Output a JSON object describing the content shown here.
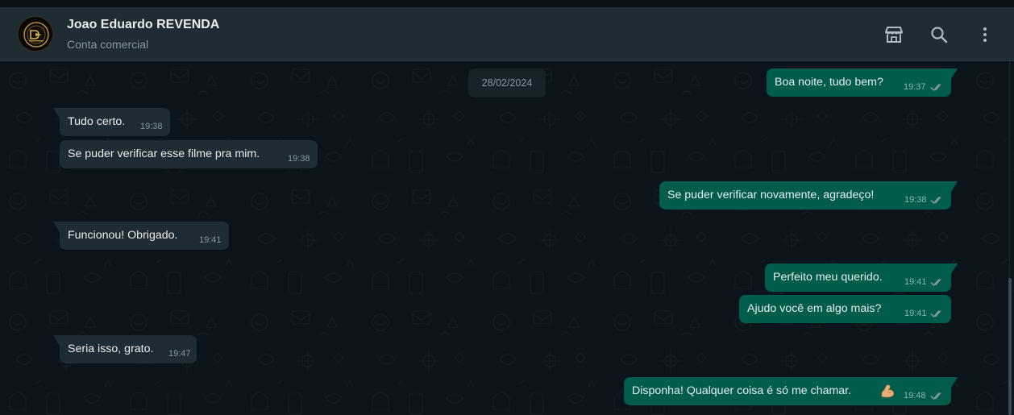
{
  "contact": {
    "name": "Joao Eduardo REVENDA",
    "subtitle": "Conta comercial"
  },
  "header_icons": [
    "shop-icon",
    "search-icon",
    "menu-icon"
  ],
  "date_label": "28/02/2024",
  "messages": [
    {
      "direction": "out",
      "text": "Boa noite, tudo bem?",
      "time": "19:37",
      "status": "read"
    },
    {
      "direction": "in",
      "text": "Tudo certo.",
      "time": "19:38"
    },
    {
      "direction": "in",
      "text": "Se puder verificar esse filme pra mim.",
      "time": "19:38"
    },
    {
      "direction": "out",
      "text": "Se puder verificar novamente, agradeço!",
      "time": "19:38",
      "status": "read"
    },
    {
      "direction": "in",
      "text": "Funcionou! Obrigado.",
      "time": "19:41"
    },
    {
      "direction": "out",
      "text": "Perfeito meu querido.",
      "time": "19:41",
      "status": "read"
    },
    {
      "direction": "out",
      "text": "Ajudo você em algo mais?",
      "time": "19:41",
      "status": "read"
    },
    {
      "direction": "in",
      "text": "Seria isso, grato.",
      "time": "19:47"
    },
    {
      "direction": "out",
      "text": "Disponha! Qualquer coisa é só me chamar.",
      "emoji": "flexed-biceps",
      "time": "19:48",
      "status": "read"
    }
  ],
  "colors": {
    "header_bg": "#202c33",
    "chat_bg": "#0b141a",
    "incoming_bubble": "#202c33",
    "outgoing_bubble": "#005c4b",
    "primary_text": "#e9edef",
    "secondary_text": "#8696a0"
  }
}
